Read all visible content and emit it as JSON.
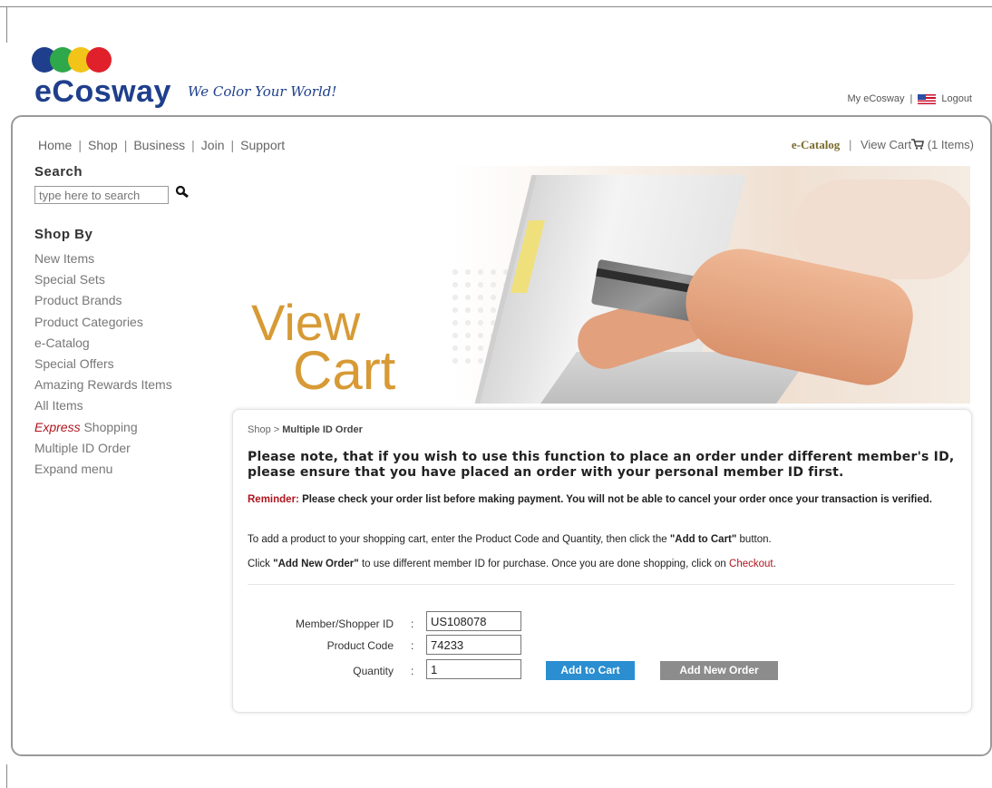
{
  "brand": {
    "name": "eCosway",
    "tagline": "We Color Your World!",
    "dot_colors": [
      "#1f3f8c",
      "#2ea84a",
      "#f2c318",
      "#e0202a"
    ]
  },
  "toplinks": {
    "my_ecosway": "My eCosway",
    "separator": "|",
    "logout": "Logout"
  },
  "nav": {
    "items": [
      "Home",
      "Shop",
      "Business",
      "Join",
      "Support"
    ],
    "ecatalog": "e-Catalog",
    "view_cart": "View Cart",
    "cart_count": "(1 Items)"
  },
  "search": {
    "title": "Search",
    "placeholder": "type here to search"
  },
  "shop_by": {
    "title": "Shop By",
    "items": [
      "New Items",
      "Special Sets",
      "Product Brands",
      "Product Categories",
      "e-Catalog",
      "Special Offers",
      "Amazing Rewards Items",
      "All Items"
    ],
    "express_prefix": "Express",
    "express_suffix": " Shopping",
    "more_items": [
      "Multiple ID Order",
      "Expand menu"
    ]
  },
  "banner": {
    "line1": "View",
    "line2": "Cart"
  },
  "content": {
    "breadcrumb_shop": "Shop",
    "breadcrumb_sep": " > ",
    "breadcrumb_current": "Multiple ID Order",
    "notice": "Please note, that if you wish to use this function to place an order under different member's ID, please ensure that you have placed an order with your personal member ID first.",
    "reminder_label": "Reminder:",
    "reminder_text": " Please check your order list before making payment. You will not be able to cancel your order once your transaction is verified.",
    "para1_a": "To add a product to your shopping cart, enter the Product Code and Quantity, then click the ",
    "para1_b": "\"Add to Cart\"",
    "para1_c": " button.",
    "para2_a": "Click ",
    "para2_b": "\"Add New Order\"",
    "para2_c": " to use different member ID for purchase. Once you are done shopping, click on ",
    "para2_checkout": "Checkout",
    "para2_d": "."
  },
  "form": {
    "member_label": "Member/Shopper ID",
    "member_value": "US108078",
    "product_label": "Product Code",
    "product_value": "74233",
    "quantity_label": "Quantity",
    "quantity_value": "1",
    "colon": ":",
    "add_to_cart": "Add to Cart",
    "add_new_order": "Add New Order"
  }
}
